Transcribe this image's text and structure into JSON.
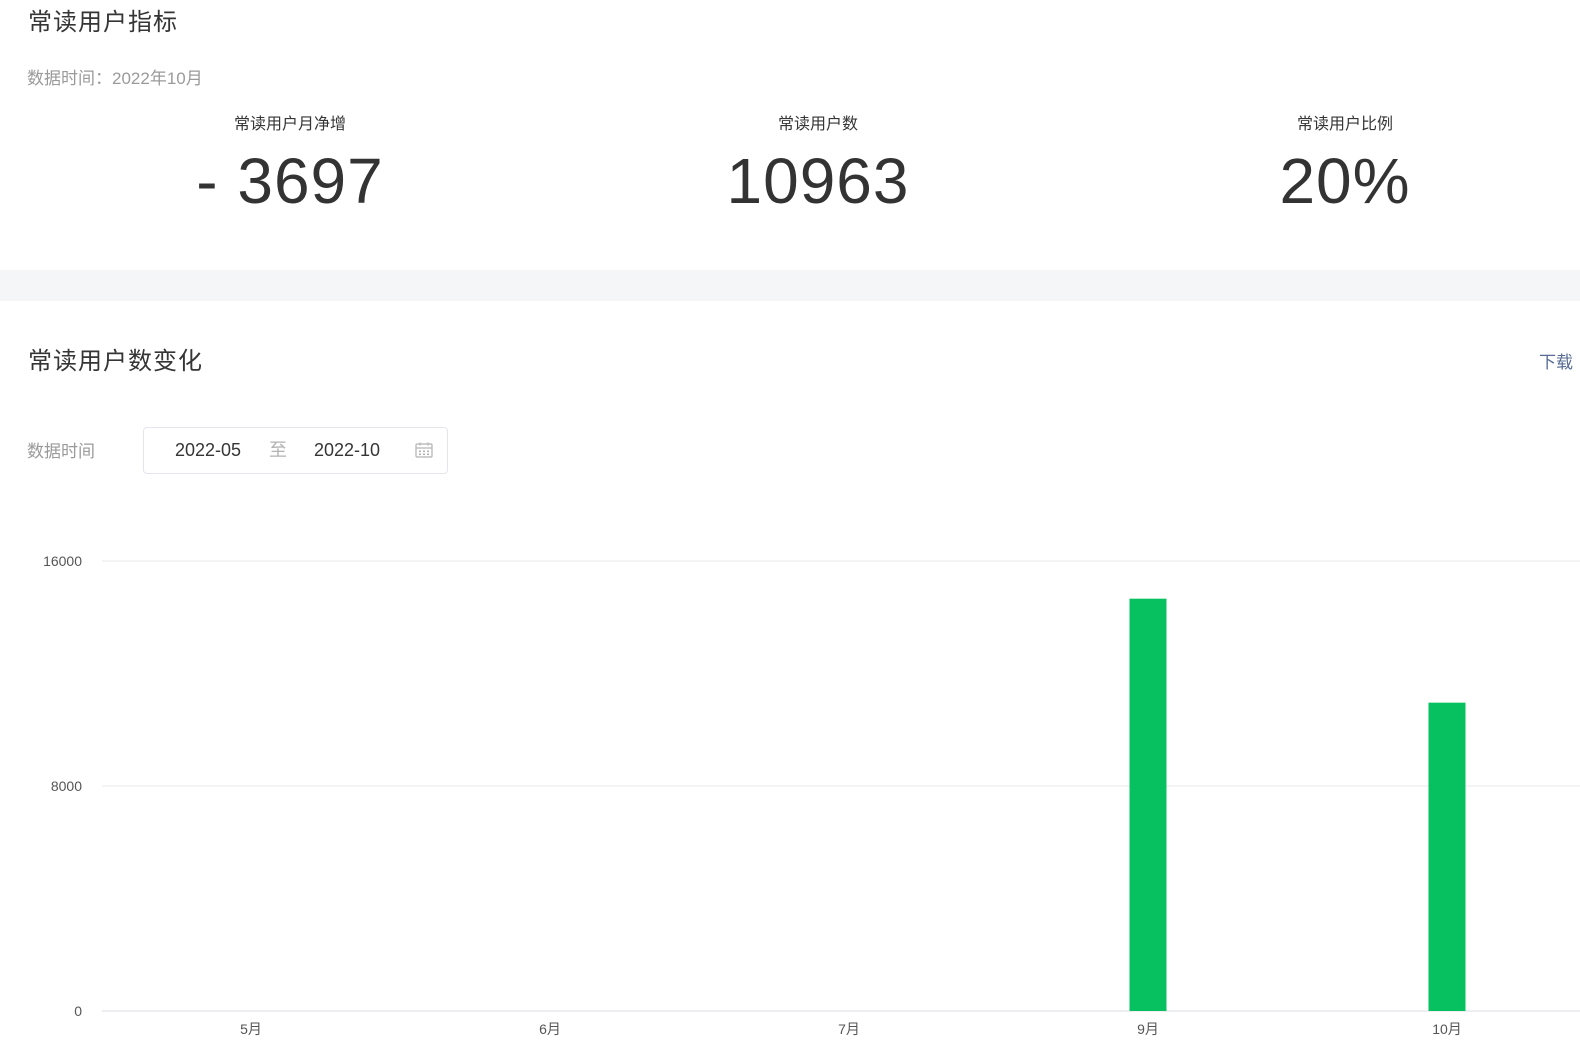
{
  "metrics": {
    "title": "常读用户指标",
    "date_text": "数据时间：2022年10月",
    "items": [
      {
        "label": "常读用户月净增",
        "value": "- 3697"
      },
      {
        "label": "常读用户数",
        "value": "10963"
      },
      {
        "label": "常读用户比例",
        "value": "20%"
      }
    ]
  },
  "trend": {
    "title": "常读用户数变化",
    "download_label": "下载",
    "range": {
      "label": "数据时间",
      "start": "2022-05",
      "separator": "至",
      "end": "2022-10",
      "icon": "calendar-icon"
    }
  },
  "colors": {
    "bar": "#07c160",
    "link": "#576b95",
    "divider_band": "#f5f6f7"
  },
  "chart_data": {
    "type": "bar",
    "categories": [
      "5月",
      "6月",
      "7月",
      "9月",
      "10月"
    ],
    "values": [
      0,
      0,
      0,
      14660,
      10963
    ],
    "y_ticks": [
      "0",
      "8000",
      "16000"
    ],
    "ylim": [
      0,
      16000
    ],
    "grid": true,
    "legend": "none"
  }
}
